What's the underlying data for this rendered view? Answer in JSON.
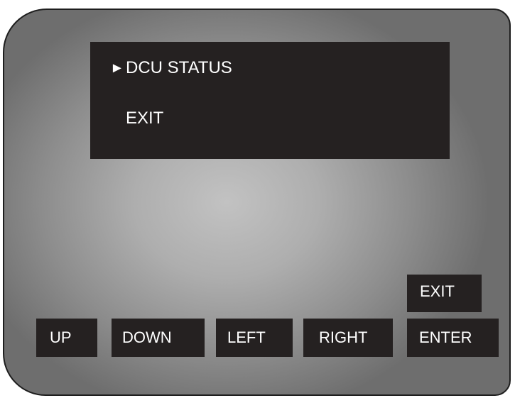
{
  "screen": {
    "selector_symbol": "►",
    "items": [
      {
        "label": "DCU STATUS",
        "selected": true
      },
      {
        "label": "EXIT",
        "selected": false
      }
    ]
  },
  "buttons": {
    "exit": "EXIT",
    "up": "UP",
    "down": "DOWN",
    "left": "LEFT",
    "right": "RIGHT",
    "enter": "ENTER"
  },
  "colors": {
    "display_background": "#252121",
    "button_background": "#252121",
    "text": "#ffffff",
    "panel_center": "#c2c2c2",
    "panel_edge": "#6e6e6e"
  }
}
